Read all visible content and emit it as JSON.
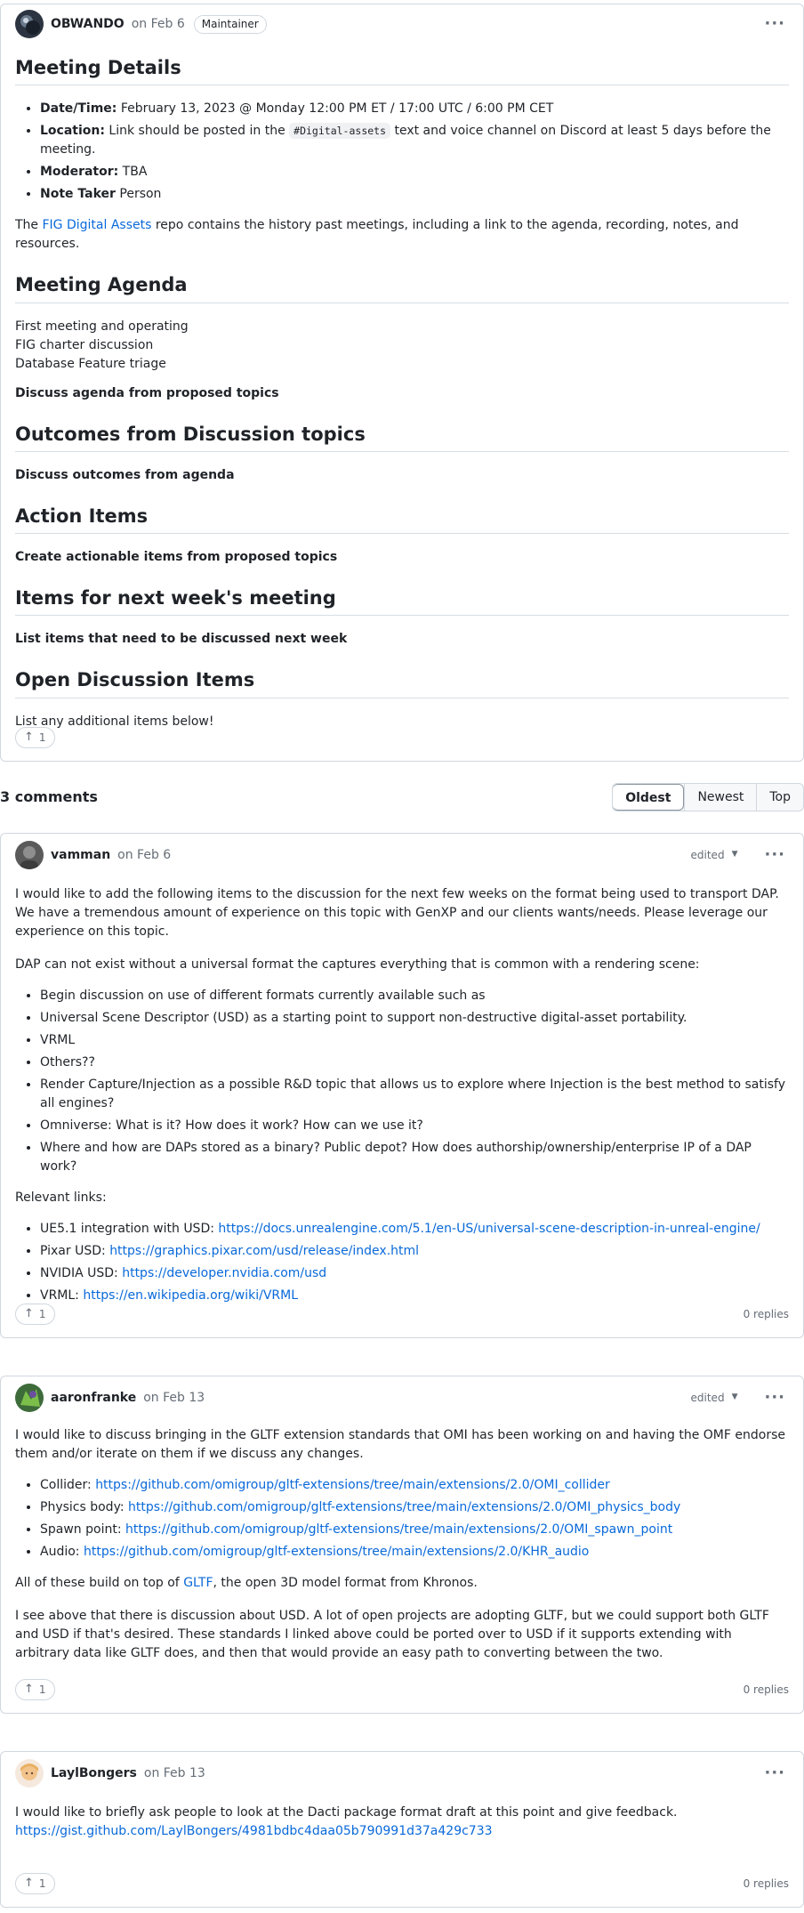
{
  "post": {
    "author": "OBWANDO",
    "date": "on Feb 6",
    "badge": "Maintainer",
    "sections": {
      "meeting_details": "Meeting Details",
      "meeting_agenda": "Meeting Agenda",
      "outcomes": "Outcomes from Discussion topics",
      "action_items": "Action Items",
      "next_week": "Items for next week's meeting",
      "open_discussion": "Open Discussion Items"
    },
    "details": {
      "datetime_label": "Date/Time:",
      "datetime_value": " February 13, 2023 @ Monday 12:00 PM ET / 17:00 UTC / 6:00 PM CET",
      "location_label": "Location:",
      "location_pre": " Link should be posted in the ",
      "location_code": "#Digital-assets",
      "location_post": " text and voice channel on Discord at least 5 days before the meeting.",
      "moderator_label": "Moderator:",
      "moderator_value": " TBA",
      "notetaker_label": "Note Taker",
      "notetaker_value": " Person",
      "repo_pre": "The ",
      "repo_link": "FIG Digital Assets",
      "repo_post": " repo contains the history past meetings, including a link to the agenda, recording, notes, and resources."
    },
    "agenda": {
      "line1": "First meeting and operating",
      "line2": "FIG charter discussion",
      "line3": "Database Feature triage",
      "bold": "Discuss agenda from proposed topics"
    },
    "outcomes_text": "Discuss outcomes from agenda",
    "action_text": "Create actionable items from proposed topics",
    "next_week_text": "List items that need to be discussed next week",
    "open_text": "List any additional items below!",
    "votes": "1"
  },
  "comments_header": {
    "count": "3 comments",
    "sort_options": [
      "Oldest",
      "Newest",
      "Top"
    ]
  },
  "comments": [
    {
      "author": "vamman",
      "date": "on Feb 6",
      "edited": "edited",
      "p1": "I would like to add the following items to the discussion for the next few weeks on the format being used to transport DAP. We have a tremendous amount of experience on this topic with GenXP and our clients wants/needs. Please leverage our experience on this topic.",
      "p2": "DAP can not exist without a universal format the captures everything that is common with a rendering scene:",
      "items": [
        "Begin discussion on use of different formats currently available such as",
        "Universal Scene Descriptor (USD) as a starting point to support non-destructive digital-asset portability.",
        "VRML",
        "Others??",
        "Render Capture/Injection as a possible R&D topic that allows us to explore where Injection is the best method to satisfy all engines?",
        "Omniverse: What is it? How does it work? How can we use it?",
        "Where and how are DAPs stored as a binary? Public depot? How does authorship/ownership/enterprise IP of a DAP work?"
      ],
      "links_label": "Relevant links:",
      "links": [
        {
          "label": "UE5.1 integration with USD: ",
          "url": "https://docs.unrealengine.com/5.1/en-US/universal-scene-description-in-unreal-engine/"
        },
        {
          "label": "Pixar USD: ",
          "url": "https://graphics.pixar.com/usd/release/index.html"
        },
        {
          "label": "NVIDIA USD: ",
          "url": "https://developer.nvidia.com/usd"
        },
        {
          "label": "VRML: ",
          "url": "https://en.wikipedia.org/wiki/VRML"
        }
      ],
      "votes": "1",
      "replies": "0 replies"
    },
    {
      "author": "aaronfranke",
      "date": "on Feb 13",
      "edited": "edited",
      "p1": "I would like to discuss bringing in the GLTF extension standards that OMI has been working on and having the OMF endorse them and/or iterate on them if we discuss any changes.",
      "links": [
        {
          "label": "Collider: ",
          "url": "https://github.com/omigroup/gltf-extensions/tree/main/extensions/2.0/OMI_collider"
        },
        {
          "label": "Physics body: ",
          "url": "https://github.com/omigroup/gltf-extensions/tree/main/extensions/2.0/OMI_physics_body"
        },
        {
          "label": "Spawn point: ",
          "url": "https://github.com/omigroup/gltf-extensions/tree/main/extensions/2.0/OMI_spawn_point"
        },
        {
          "label": "Audio: ",
          "url": "https://github.com/omigroup/gltf-extensions/tree/main/extensions/2.0/KHR_audio"
        }
      ],
      "p2_pre": "All of these build on top of ",
      "p2_link": "GLTF",
      "p2_post": ", the open 3D model format from Khronos.",
      "p3": "I see above that there is discussion about USD. A lot of open projects are adopting GLTF, but we could support both GLTF and USD if that's desired. These standards I linked above could be ported over to USD if it supports extending with arbitrary data like GLTF does, and then that would provide an easy path to converting between the two.",
      "votes": "1",
      "replies": "0 replies"
    },
    {
      "author": "LaylBongers",
      "date": "on Feb 13",
      "p1": "I would like to briefly ask people to look at the Dacti package format draft at this point and give feedback.",
      "link": "https://gist.github.com/LaylBongers/4981bdbc4daa05b790991d37a429c733",
      "votes": "1",
      "replies": "0 replies"
    }
  ]
}
